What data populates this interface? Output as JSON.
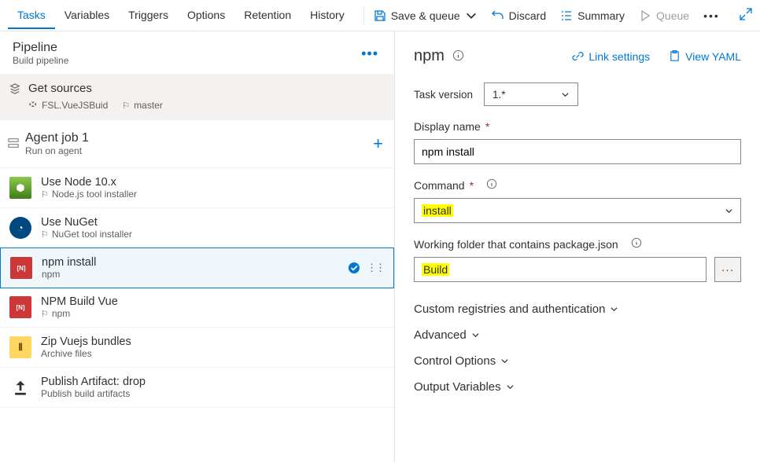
{
  "tabs": [
    "Tasks",
    "Variables",
    "Triggers",
    "Options",
    "Retention",
    "History"
  ],
  "activeTab": 0,
  "toolbar": {
    "save": "Save & queue",
    "discard": "Discard",
    "summary": "Summary",
    "queue": "Queue"
  },
  "pipeline": {
    "title": "Pipeline",
    "subtitle": "Build pipeline"
  },
  "sources": {
    "label": "Get sources",
    "repo": "FSL.VueJSBuid",
    "branch": "master"
  },
  "job": {
    "title": "Agent job 1",
    "subtitle": "Run on agent"
  },
  "tasks": [
    {
      "name": "Use Node 10.x",
      "sub": "Node.js tool installer",
      "icon": "node"
    },
    {
      "name": "Use NuGet",
      "sub": "NuGet tool installer",
      "icon": "nuget"
    },
    {
      "name": "npm install",
      "sub": "npm",
      "icon": "npm",
      "selected": true,
      "checked": true
    },
    {
      "name": "NPM Build Vue",
      "sub": "npm",
      "icon": "npm"
    },
    {
      "name": "Zip Vuejs bundles",
      "sub": "Archive files",
      "icon": "zip"
    },
    {
      "name": "Publish Artifact: drop",
      "sub": "Publish build artifacts",
      "icon": "publish"
    }
  ],
  "details": {
    "taskName": "npm",
    "linkSettings": "Link settings",
    "viewYaml": "View YAML",
    "taskVersionLabel": "Task version",
    "taskVersionValue": "1.*",
    "displayNameLabel": "Display name",
    "displayNameValue": "npm install",
    "commandLabel": "Command",
    "commandValue": "install",
    "workingFolderLabel": "Working folder that contains package.json",
    "workingFolderValue": "Build",
    "sections": [
      "Custom registries and authentication",
      "Advanced",
      "Control Options",
      "Output Variables"
    ]
  }
}
